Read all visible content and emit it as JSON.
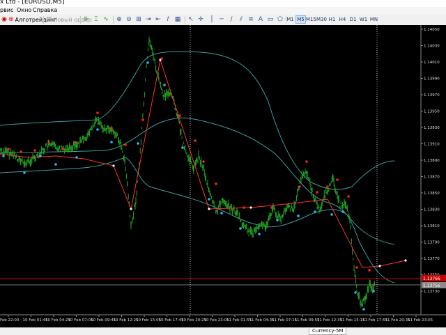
{
  "window": {
    "title": "x Ltd - [EURUSD,M5]"
  },
  "menu": {
    "items": [
      "рвис",
      "Окно",
      "Справка"
    ]
  },
  "toolbar": {
    "algo_label": "Алготрейдинг",
    "new_order_label": "Новый ордер",
    "timeframes": [
      "M1",
      "M5",
      "M15",
      "M30",
      "H1",
      "H4",
      "D1",
      "W1",
      "MN"
    ],
    "active_timeframe": "M5"
  },
  "chart": {
    "symbol": "EURUSD",
    "timeframe": "M5",
    "price_labels": [
      "1.14050",
      "1.14030",
      "1.14010",
      "1.13990",
      "1.13970",
      "1.13950",
      "1.13930",
      "1.13910",
      "1.13890",
      "1.13870",
      "1.13850",
      "1.13830",
      "1.13810",
      "1.13790",
      "1.13770",
      "1.13750",
      "1.13730"
    ],
    "time_labels": [
      "Feb 22:00",
      "10 Feb 01:45",
      "10 Feb 04:25",
      "10 Feb 07:05",
      "10 Feb 09:45",
      "10 Feb 12:25",
      "10 Feb 15:05",
      "10 Feb 17:45",
      "10 Feb 20:25",
      "10 Feb 23:05",
      "11 Feb 01:55",
      "11 Feb 04:35",
      "11 Feb 07:15",
      "11 Feb 09:55",
      "11 Feb 12:35",
      "11 Feb 15:15",
      "11 Feb 17:55",
      "11 Feb 20:35",
      "11 Feb 23:05"
    ],
    "red_line_price_label": "1.13766",
    "bid_price_label": "1.13756",
    "colors": {
      "candles": "#22aa22",
      "bands": "#3d9e9e",
      "red_line": "#cc0000",
      "zigzag": "#ff3333",
      "buy_dot": "#22bbff",
      "sell_dot": "#ff2222"
    }
  },
  "statusbar": {
    "tab_label": "Currency-5M"
  }
}
